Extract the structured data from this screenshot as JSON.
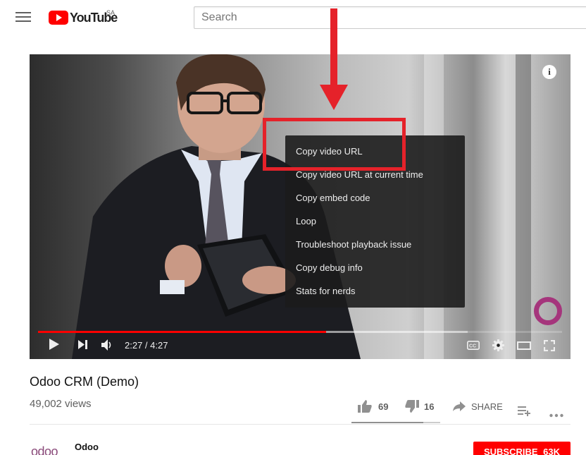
{
  "header": {
    "logo_text": "YouTube",
    "country_code": "SA",
    "search_placeholder": "Search"
  },
  "player": {
    "current_time": "2:27",
    "duration": "4:27",
    "time_separator": " / ",
    "progress_played_fraction": 0.55,
    "progress_loaded_fraction": 0.82,
    "info_label": "i"
  },
  "context_menu": {
    "items": [
      "Copy video URL",
      "Copy video URL at current time",
      "Copy embed code",
      "Loop",
      "Troubleshoot playback issue",
      "Copy debug info",
      "Stats for nerds"
    ]
  },
  "video": {
    "title": "Odoo CRM (Demo)",
    "views": "49,002 views",
    "likes": "69",
    "dislikes": "16",
    "share_label": "SHARE",
    "like_ratio": 0.81
  },
  "channel": {
    "logo_text": "odoo",
    "name": "Odoo",
    "subscribe_label": "SUBSCRIBE",
    "subscriber_count": "63K"
  },
  "colors": {
    "brand_red": "#ff0000",
    "annotation_red": "#e5222a",
    "channel_purple": "#a5357c"
  }
}
